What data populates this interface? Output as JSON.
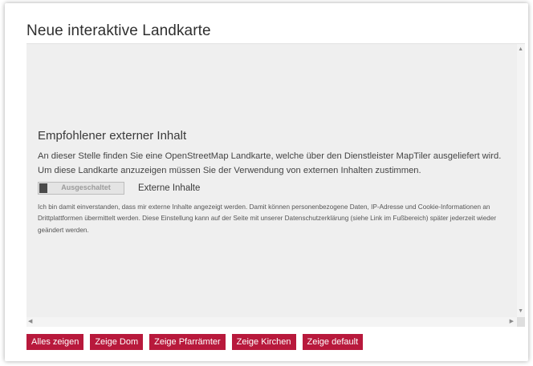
{
  "title": "Neue interaktive Landkarte",
  "consent": {
    "heading": "Empfohlener externer Inhalt",
    "text": "An dieser Stelle finden Sie eine OpenStreetMap Landkarte, welche über den Dienstleister MapTiler ausgeliefert wird. Um diese Landkarte anzuzeigen müssen Sie der Verwendung von externen Inhalten zustimmen.",
    "toggle_state_label": "Ausgeschaltet",
    "toggle_caption": "Externe Inhalte",
    "toggle_on": false,
    "disclaimer": "Ich bin damit einverstanden, dass mir externe Inhalte angezeigt werden. Damit können personenbezogene Daten, IP-Adresse und Cookie-Informationen an Drittplattformen übermittelt werden. Diese Einstellung kann auf der Seite mit unserer Datenschutzerklärung (siehe Link im Fußbereich) später jederzeit wieder geändert werden."
  },
  "buttons": [
    {
      "label": "Alles zeigen"
    },
    {
      "label": "Zeige Dom"
    },
    {
      "label": "Zeige Pfarrämter"
    },
    {
      "label": "Zeige Kirchen"
    },
    {
      "label": "Zeige default"
    }
  ],
  "colors": {
    "button_bg": "#b8193c",
    "map_bg": "#efefef"
  }
}
